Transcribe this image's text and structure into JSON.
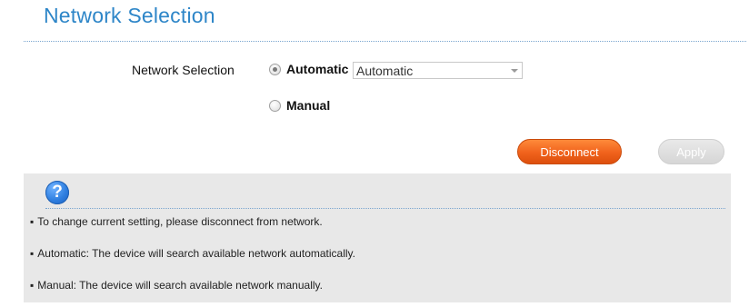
{
  "page": {
    "title": "Network Selection"
  },
  "form": {
    "label": "Network Selection",
    "options": [
      {
        "label": "Automatic",
        "checked": true
      },
      {
        "label": "Manual",
        "checked": false
      }
    ],
    "select_value": "Automatic"
  },
  "buttons": {
    "disconnect": "Disconnect",
    "apply": "Apply"
  },
  "help": {
    "icon": "question-mark-icon",
    "lines": [
      "To change current setting, please disconnect from network.",
      "Automatic: The device will search available network automatically.",
      "Manual: The device will search available network manually."
    ]
  },
  "colors": {
    "title": "#2e86c8",
    "disconnect_button": "#f0621c",
    "apply_button_disabled": "#d6d6d6",
    "help_panel": "#e8e8e8",
    "help_icon": "#2f7fe0"
  }
}
